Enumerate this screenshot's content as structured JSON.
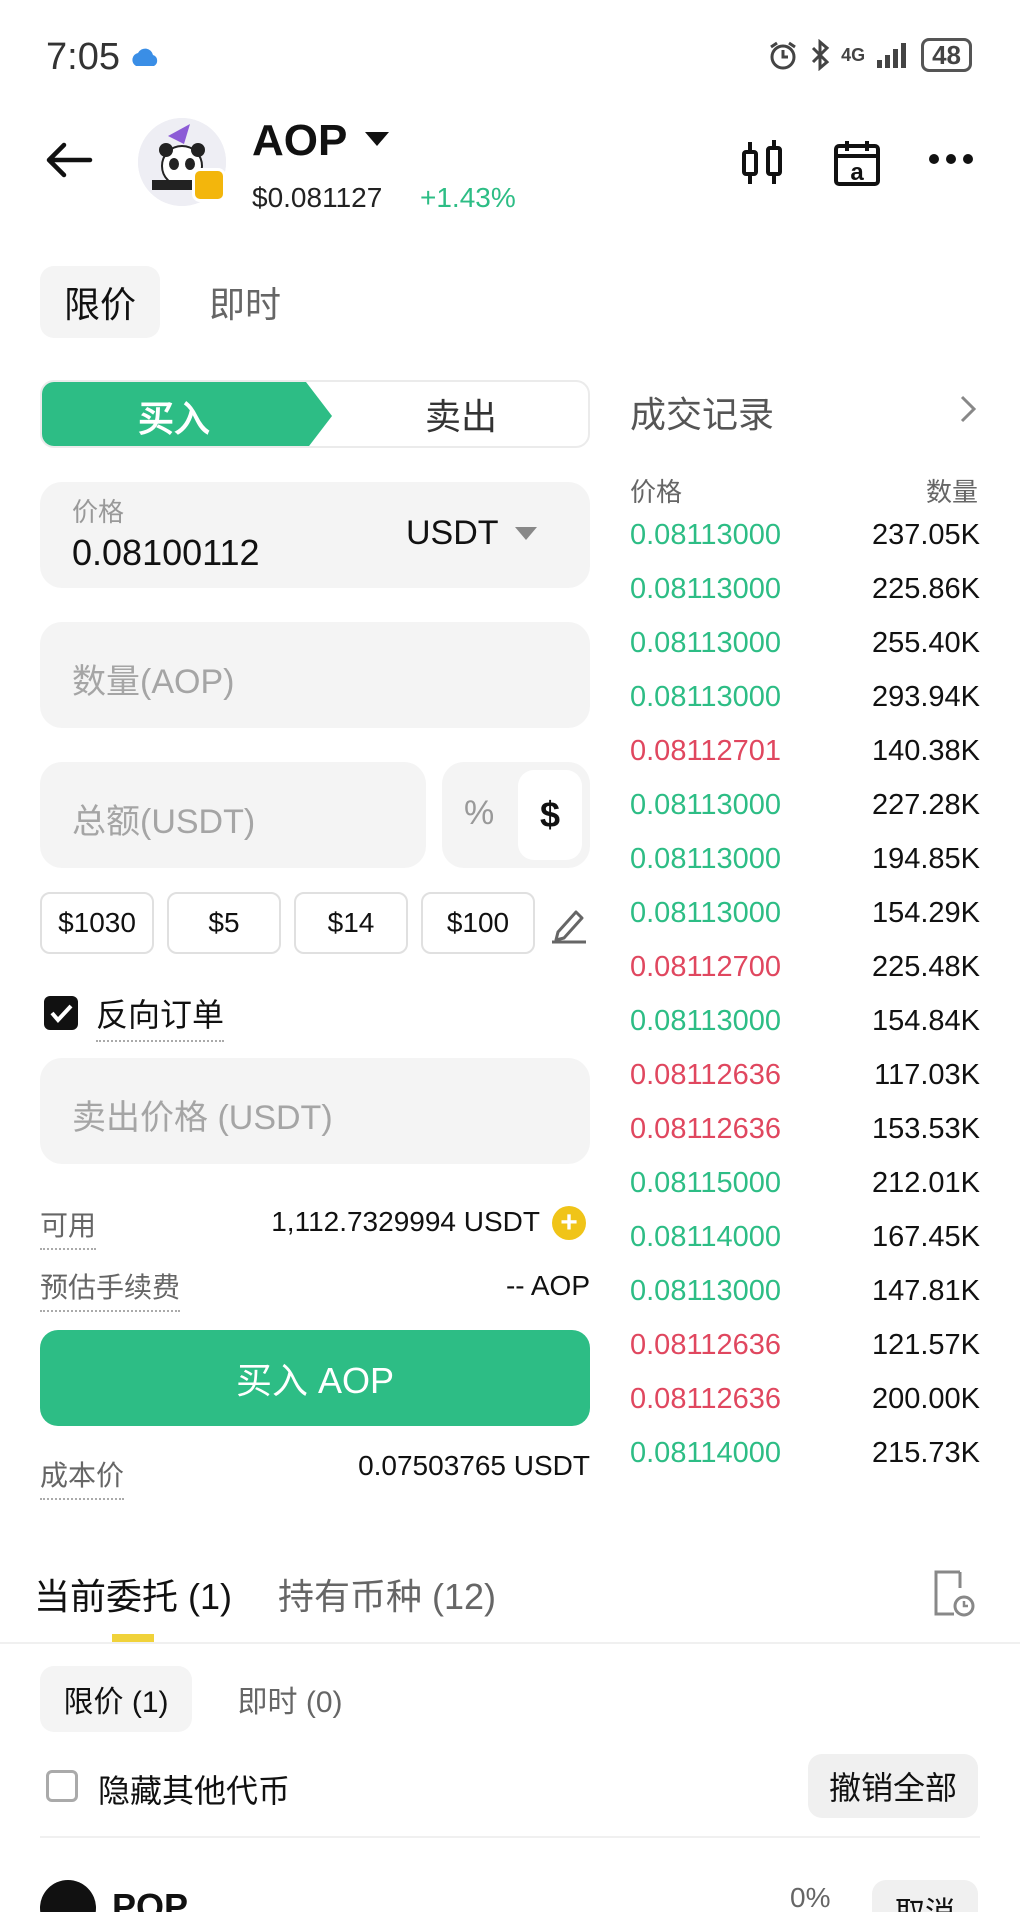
{
  "status_bar": {
    "time": "7:05",
    "network": "4G",
    "battery": "48"
  },
  "header": {
    "token_name": "AOP",
    "price": "$0.081127",
    "change": "+1.43%"
  },
  "order_type_tabs": [
    "限价",
    "即时"
  ],
  "trade_panel": {
    "buy_label": "买入",
    "sell_label": "卖出",
    "price_label": "价格",
    "price_value": "0.08100112",
    "price_unit": "USDT",
    "quantity_placeholder": "数量(AOP)",
    "total_placeholder": "总额(USDT)",
    "mode_percent": "%",
    "mode_dollar": "$",
    "quick_amounts": [
      "$1030",
      "$5",
      "$14",
      "$100"
    ],
    "reverse_order_label": "反向订单",
    "sell_price_placeholder": "卖出价格 (USDT)",
    "available_label": "可用",
    "available_value": "1,112.7329994 USDT",
    "fee_label": "预估手续费",
    "fee_value": "-- AOP",
    "buy_button": "买入 AOP",
    "cost_label": "成本价",
    "cost_value": "0.07503765 USDT"
  },
  "trade_history": {
    "title": "成交记录",
    "col_price": "价格",
    "col_qty": "数量",
    "rows": [
      {
        "price": "0.08113000",
        "qty": "237.05K",
        "side": "buy"
      },
      {
        "price": "0.08113000",
        "qty": "225.86K",
        "side": "buy"
      },
      {
        "price": "0.08113000",
        "qty": "255.40K",
        "side": "buy"
      },
      {
        "price": "0.08113000",
        "qty": "293.94K",
        "side": "buy"
      },
      {
        "price": "0.08112701",
        "qty": "140.38K",
        "side": "sell"
      },
      {
        "price": "0.08113000",
        "qty": "227.28K",
        "side": "buy"
      },
      {
        "price": "0.08113000",
        "qty": "194.85K",
        "side": "buy"
      },
      {
        "price": "0.08113000",
        "qty": "154.29K",
        "side": "buy"
      },
      {
        "price": "0.08112700",
        "qty": "225.48K",
        "side": "sell"
      },
      {
        "price": "0.08113000",
        "qty": "154.84K",
        "side": "buy"
      },
      {
        "price": "0.08112636",
        "qty": "117.03K",
        "side": "sell"
      },
      {
        "price": "0.08112636",
        "qty": "153.53K",
        "side": "sell"
      },
      {
        "price": "0.08115000",
        "qty": "212.01K",
        "side": "buy"
      },
      {
        "price": "0.08114000",
        "qty": "167.45K",
        "side": "buy"
      },
      {
        "price": "0.08113000",
        "qty": "147.81K",
        "side": "buy"
      },
      {
        "price": "0.08112636",
        "qty": "121.57K",
        "side": "sell"
      },
      {
        "price": "0.08112636",
        "qty": "200.00K",
        "side": "sell"
      },
      {
        "price": "0.08114000",
        "qty": "215.73K",
        "side": "buy"
      }
    ]
  },
  "orders_section": {
    "tab_open": "当前委托 (1)",
    "tab_holdings": "持有币种 (12)",
    "sub_tab_limit": "限价 (1)",
    "sub_tab_instant": "即时 (0)",
    "hide_other_label": "隐藏其他代币",
    "cancel_all": "撤销全部",
    "order_token": "POP",
    "order_percent": "0%",
    "order_cancel": "取消"
  },
  "colors": {
    "green": "#2dbd85",
    "red": "#e0475f",
    "yellow": "#f0d23a"
  }
}
